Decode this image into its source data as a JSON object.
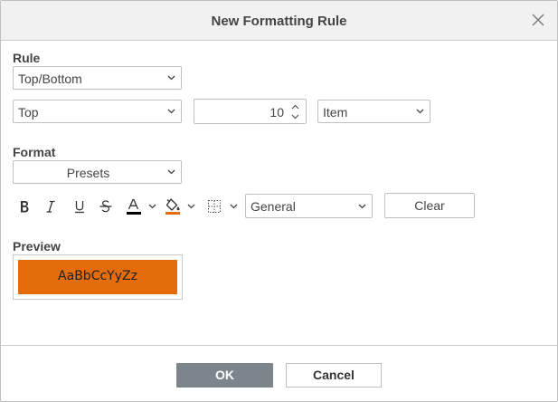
{
  "dialog": {
    "title": "New Formatting Rule",
    "icons": {
      "close": "close-icon"
    }
  },
  "rule": {
    "label": "Rule",
    "type_select": "Top/Bottom",
    "direction_select": "Top",
    "count_value": "10",
    "unit_select": "Item"
  },
  "format": {
    "label": "Format",
    "presets_select": "Presets",
    "toolbar": {
      "icons": [
        "bold-icon",
        "italic-icon",
        "underline-icon",
        "strikethrough-icon",
        "font-color-icon",
        "fill-color-icon",
        "borders-icon"
      ],
      "font_color": "#000000",
      "fill_color": "#e46c0a"
    },
    "number_format_select": "General",
    "clear_label": "Clear"
  },
  "preview": {
    "label": "Preview",
    "sample_text": "AaBbCcYyZz",
    "fill_color": "#e46c0a"
  },
  "footer": {
    "ok_label": "OK",
    "cancel_label": "Cancel"
  }
}
